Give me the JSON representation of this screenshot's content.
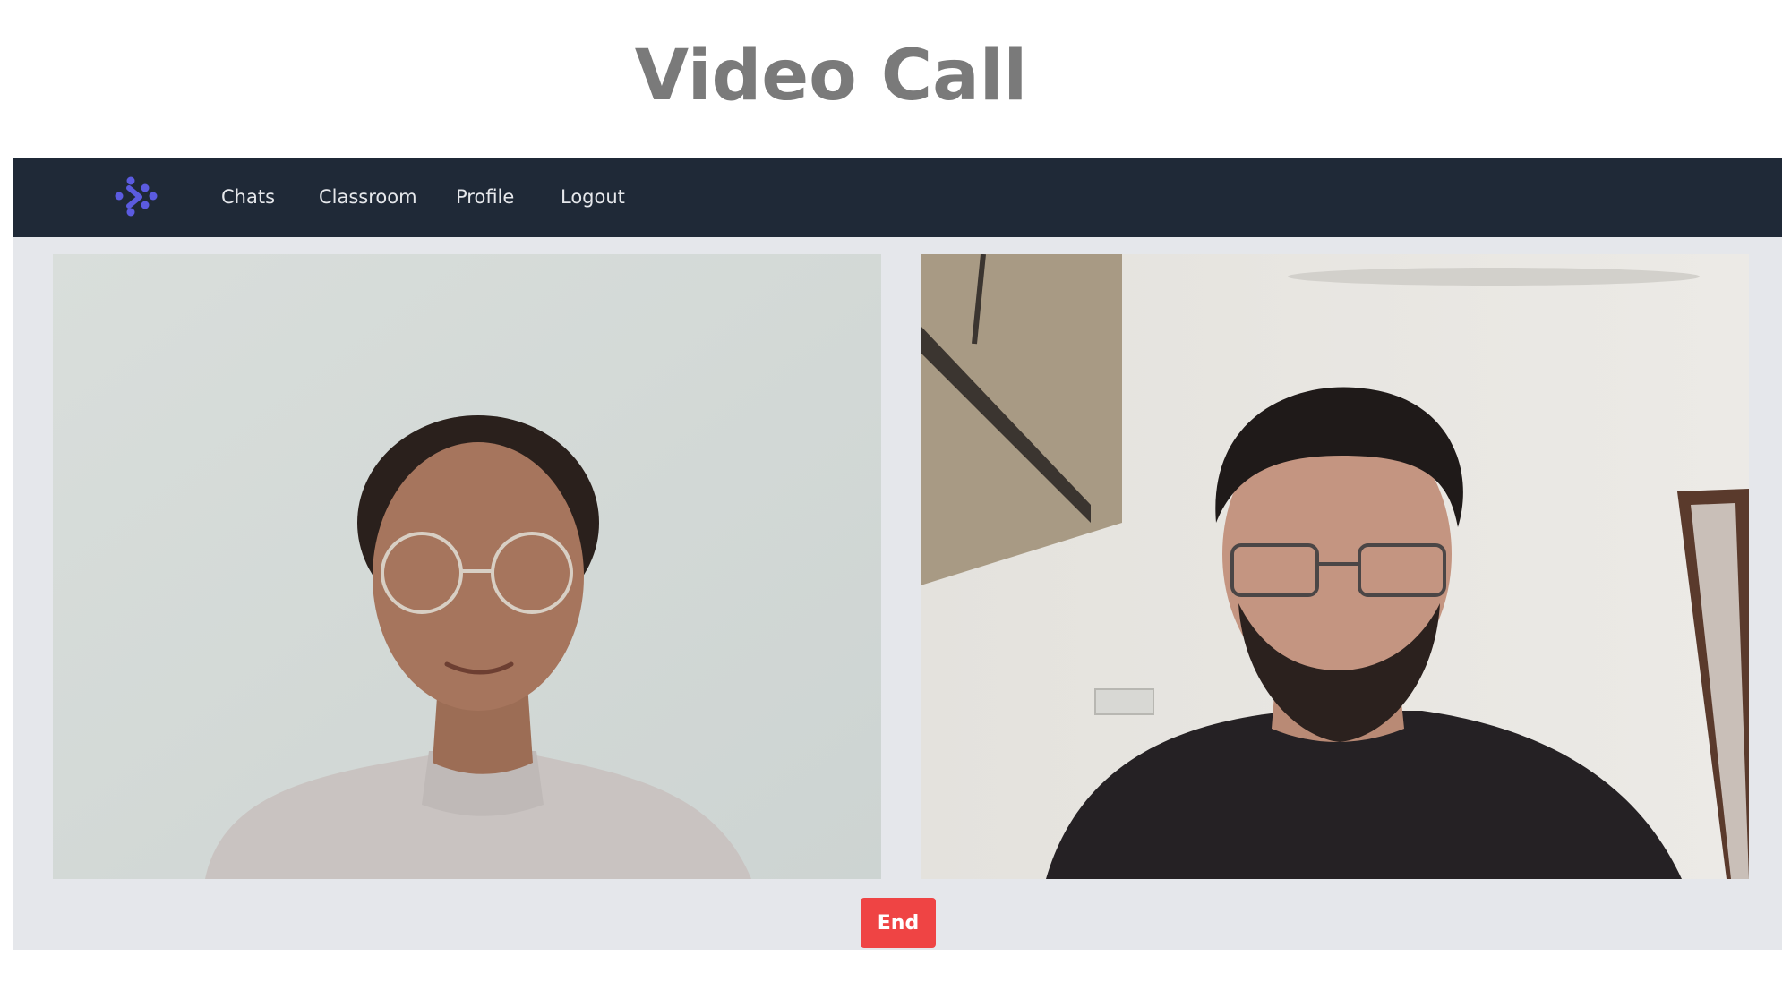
{
  "page": {
    "title": "Video Call"
  },
  "navbar": {
    "logo_icon": "brand-logo-icon",
    "links": [
      "Chats",
      "Classroom",
      "Profile",
      "Logout"
    ]
  },
  "call": {
    "participants": [
      {
        "tile": "video-tile-left"
      },
      {
        "tile": "video-tile-right"
      }
    ],
    "end_label": "End"
  },
  "colors": {
    "navbar": "#1f2937",
    "background": "#e5e7eb",
    "logo": "#5b5be0",
    "end_button": "#ef4444",
    "title": "#7a7a7a"
  }
}
